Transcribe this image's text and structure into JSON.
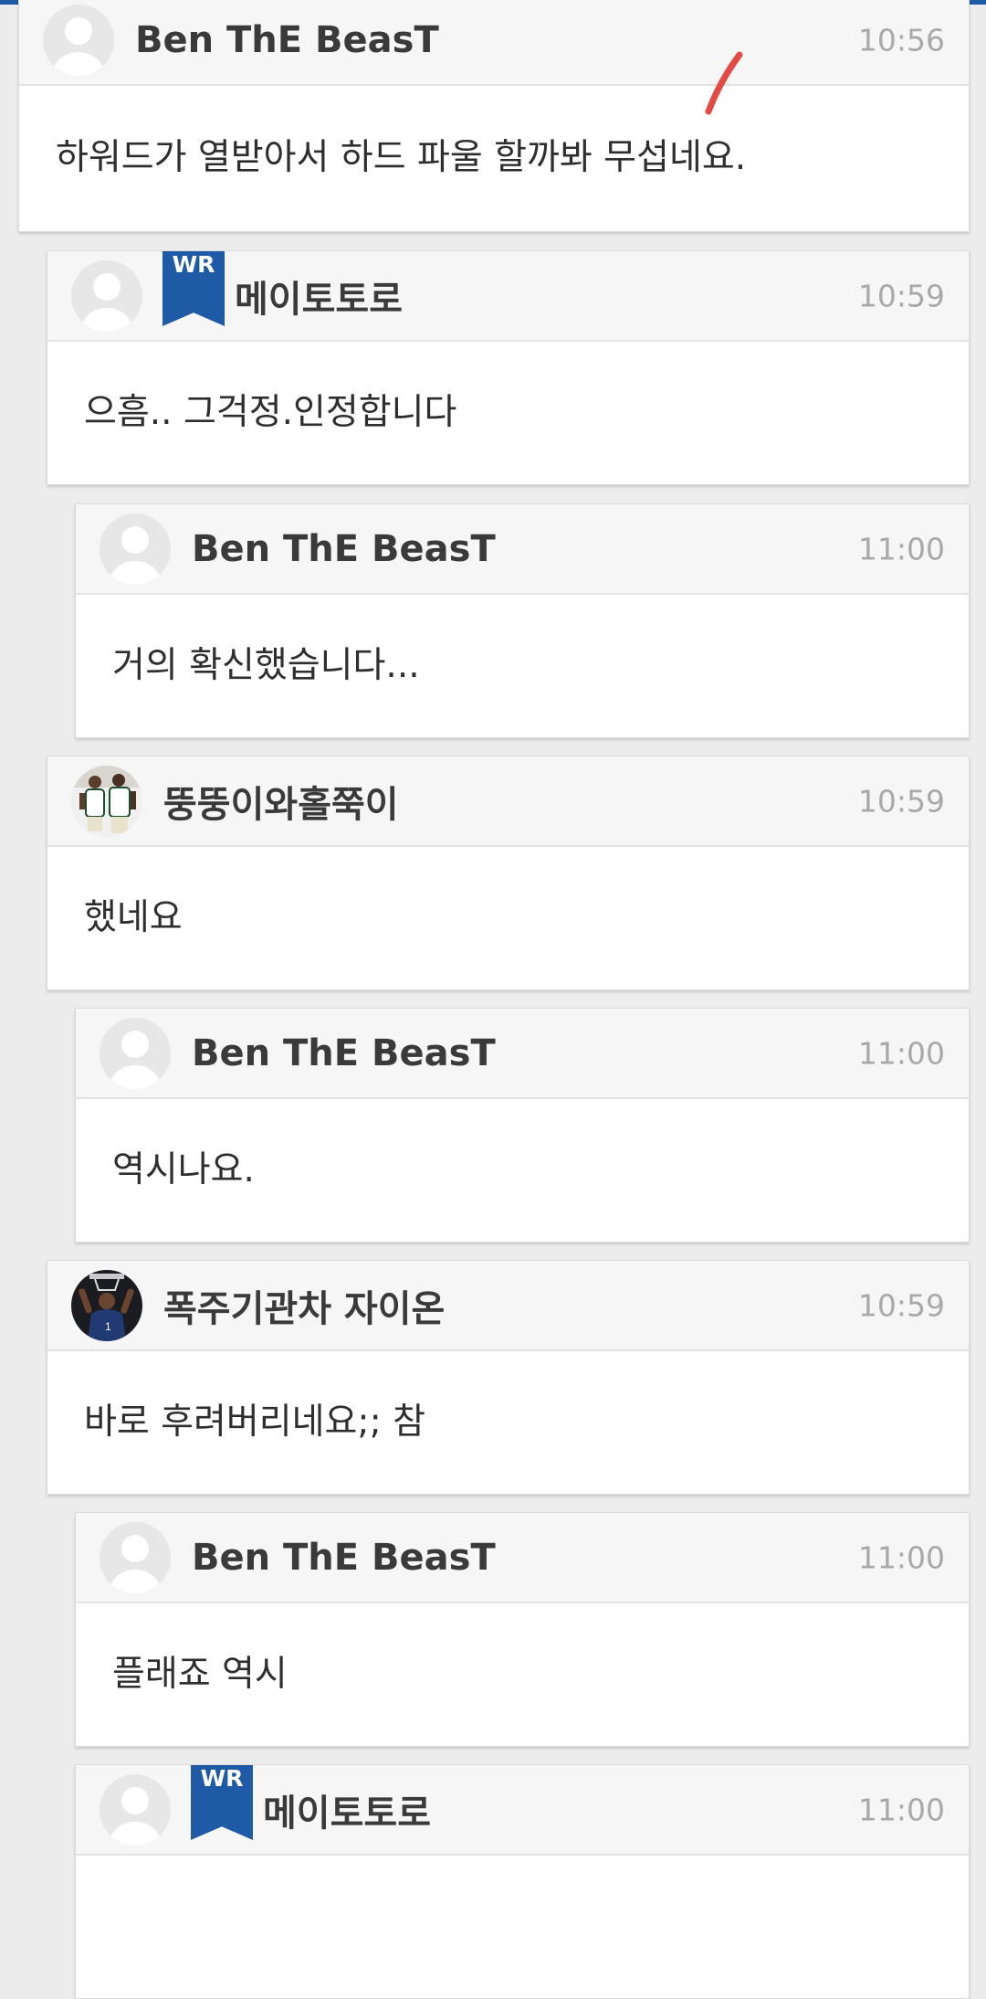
{
  "badge_label": "WR",
  "colors": {
    "accent": "#1f5aa6",
    "header_bg": "#f6f6f6",
    "page_bg": "#ececec",
    "time_text": "#a9a9a9",
    "annotation_mark": "#e24a43"
  },
  "comments": [
    {
      "author": "Ben ThE BeasT",
      "time": "10:56",
      "text": "하워드가 열받아서 하드 파울 할까봐 무섭네요.",
      "avatar": "default-avatar-icon"
    },
    {
      "author": "메이토토로",
      "time": "10:59",
      "text": "으흠.. 그걱정.인정합니다",
      "avatar": "default-avatar-icon",
      "is_writer": true
    },
    {
      "author": "Ben ThE BeasT",
      "time": "11:00",
      "text": "거의 확신했습니다...",
      "avatar": "default-avatar-icon"
    },
    {
      "author": "뚱뚱이와홀쭉이",
      "time": "10:59",
      "text": "했네요",
      "avatar": "basketball-players-photo"
    },
    {
      "author": "Ben ThE BeasT",
      "time": "11:00",
      "text": "역시나요.",
      "avatar": "default-avatar-icon"
    },
    {
      "author": "폭주기관차 자이온",
      "time": "10:59",
      "text": "바로 후려버리네요;; 참",
      "avatar": "dunking-player-photo"
    },
    {
      "author": "Ben ThE BeasT",
      "time": "11:00",
      "text": "플래죠 역시",
      "avatar": "default-avatar-icon"
    },
    {
      "author": "메이토토로",
      "time": "11:00",
      "text": "",
      "avatar": "default-avatar-icon",
      "is_writer": true
    }
  ]
}
